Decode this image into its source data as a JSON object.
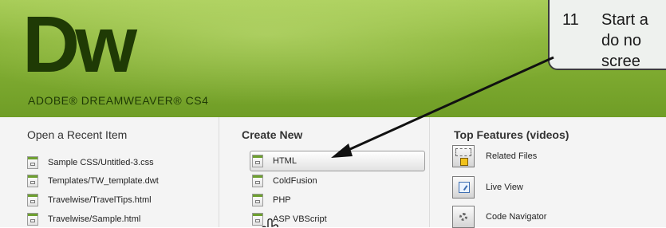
{
  "header": {
    "logo_text": "Dw",
    "product_name": "ADOBE® DREAMWEAVER® CS4"
  },
  "recent": {
    "title": "Open a Recent Item",
    "items": [
      {
        "label": "Sample CSS/Untitled-3.css"
      },
      {
        "label": "Templates/TW_template.dwt"
      },
      {
        "label": "Travelwise/TravelTips.html"
      },
      {
        "label": "Travelwise/Sample.html"
      }
    ]
  },
  "create": {
    "title": "Create New",
    "items": [
      {
        "label": "HTML"
      },
      {
        "label": "ColdFusion"
      },
      {
        "label": "PHP"
      },
      {
        "label": "ASP VBScript"
      }
    ]
  },
  "features": {
    "title": "Top Features (videos)",
    "items": [
      {
        "label": "Related Files",
        "icon": "related-files-icon"
      },
      {
        "label": "Live View",
        "icon": "live-view-icon"
      },
      {
        "label": "Code Navigator",
        "icon": "code-navigator-icon"
      }
    ]
  },
  "callout": {
    "number": "11",
    "line1": "Start a",
    "line2": "do no",
    "line3": "scree"
  },
  "colors": {
    "header_green": "#88b337",
    "logo_dark": "#1f3a05",
    "panel_bg": "#f4f4f4"
  }
}
